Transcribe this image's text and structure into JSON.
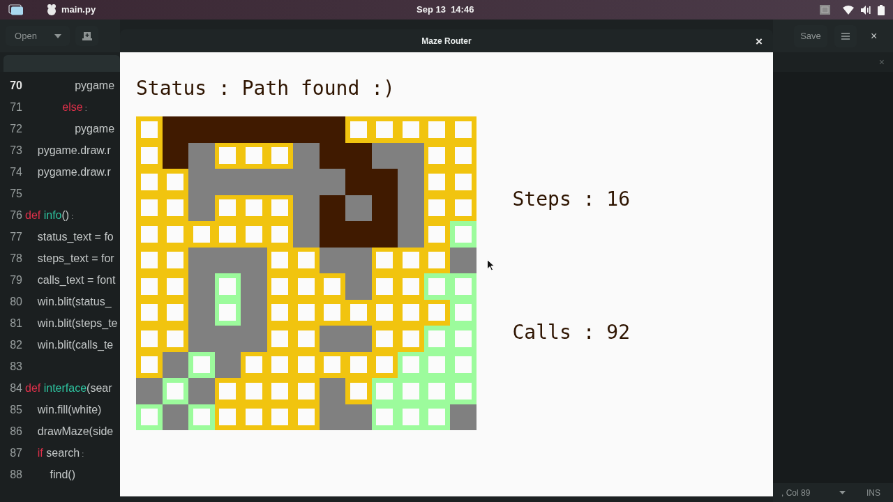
{
  "top_bar": {
    "app_title": "main.py",
    "clock": "Sep 13  14:46"
  },
  "editor": {
    "open_button": "Open",
    "save_button": "Save",
    "tab_close": "×",
    "window_close": "×",
    "lines": [
      {
        "number": "70",
        "current": true,
        "tokens": [
          {
            "text": "                pygame",
            "kind": "plain"
          }
        ]
      },
      {
        "number": "71",
        "current": false,
        "tokens": [
          {
            "text": "            else",
            "kind": "keyword"
          },
          {
            "text": " :",
            "kind": "punct"
          }
        ]
      },
      {
        "number": "72",
        "current": false,
        "tokens": [
          {
            "text": "                pygame",
            "kind": "plain"
          }
        ]
      },
      {
        "number": "73",
        "current": false,
        "tokens": [
          {
            "text": "    pygame.draw.r",
            "kind": "plain"
          }
        ]
      },
      {
        "number": "74",
        "current": false,
        "tokens": [
          {
            "text": "    pygame.draw.r",
            "kind": "plain"
          }
        ]
      },
      {
        "number": "75",
        "current": false
      },
      {
        "number": "76",
        "current": false,
        "tokens": [
          {
            "text": "def",
            "kind": "keyword"
          },
          {
            "text": " info",
            "kind": "function"
          },
          {
            "text": "()",
            "kind": "plain"
          },
          {
            "text": " :",
            "kind": "punct"
          }
        ]
      },
      {
        "number": "77",
        "current": false,
        "tokens": [
          {
            "text": "    status_text = fo",
            "kind": "plain"
          }
        ]
      },
      {
        "number": "78",
        "current": false,
        "tokens": [
          {
            "text": "    steps_text = for",
            "kind": "plain"
          }
        ]
      },
      {
        "number": "79",
        "current": false,
        "tokens": [
          {
            "text": "    calls_text = font",
            "kind": "plain"
          }
        ]
      },
      {
        "number": "80",
        "current": false,
        "tokens": [
          {
            "text": "    win.blit(status_",
            "kind": "plain"
          }
        ]
      },
      {
        "number": "81",
        "current": false,
        "tokens": [
          {
            "text": "    win.blit(steps_te",
            "kind": "plain"
          }
        ]
      },
      {
        "number": "82",
        "current": false,
        "tokens": [
          {
            "text": "    win.blit(calls_te",
            "kind": "plain"
          }
        ]
      },
      {
        "number": "83",
        "current": false
      },
      {
        "number": "84",
        "current": false,
        "tokens": [
          {
            "text": "def",
            "kind": "keyword"
          },
          {
            "text": " interface",
            "kind": "function"
          },
          {
            "text": "(sear",
            "kind": "plain"
          }
        ]
      },
      {
        "number": "85",
        "current": false,
        "tokens": [
          {
            "text": "    win.fill(white)",
            "kind": "plain"
          }
        ]
      },
      {
        "number": "86",
        "current": false,
        "tokens": [
          {
            "text": "    drawMaze(side",
            "kind": "plain"
          }
        ]
      },
      {
        "number": "87",
        "current": false,
        "tokens": [
          {
            "text": "    if",
            "kind": "keyword"
          },
          {
            "text": " search",
            "kind": "plain"
          },
          {
            "text": " :",
            "kind": "punct"
          }
        ]
      },
      {
        "number": "88",
        "current": false,
        "tokens": [
          {
            "text": "        find()",
            "kind": "plain"
          }
        ]
      }
    ],
    "status_bar": {
      "position": ", Col 89",
      "mode": "INS"
    }
  },
  "maze_window": {
    "title": "Maze Router",
    "close": "×",
    "status": "Status : Path found :)",
    "steps": "Steps : 16",
    "calls": "Calls : 92",
    "maze": {
      "rows": [
        {
          "cells": [
            {
              "kind": "visited"
            },
            {
              "kind": "path"
            },
            {
              "kind": "path"
            },
            {
              "kind": "path"
            },
            {
              "kind": "path"
            },
            {
              "kind": "path"
            },
            {
              "kind": "path"
            },
            {
              "kind": "path"
            },
            {
              "kind": "visited"
            },
            {
              "kind": "visited"
            },
            {
              "kind": "visited"
            },
            {
              "kind": "visited"
            },
            {
              "kind": "visited"
            }
          ]
        },
        {
          "cells": [
            {
              "kind": "visited"
            },
            {
              "kind": "path"
            },
            {
              "kind": "wall"
            },
            {
              "kind": "visited"
            },
            {
              "kind": "visited"
            },
            {
              "kind": "visited"
            },
            {
              "kind": "wall"
            },
            {
              "kind": "path"
            },
            {
              "kind": "path"
            },
            {
              "kind": "wall"
            },
            {
              "kind": "wall"
            },
            {
              "kind": "visited"
            },
            {
              "kind": "visited"
            }
          ]
        },
        {
          "cells": [
            {
              "kind": "visited"
            },
            {
              "kind": "visited"
            },
            {
              "kind": "wall"
            },
            {
              "kind": "wall"
            },
            {
              "kind": "wall"
            },
            {
              "kind": "wall"
            },
            {
              "kind": "wall"
            },
            {
              "kind": "wall"
            },
            {
              "kind": "path"
            },
            {
              "kind": "path"
            },
            {
              "kind": "wall"
            },
            {
              "kind": "visited"
            },
            {
              "kind": "visited"
            }
          ]
        },
        {
          "cells": [
            {
              "kind": "visited"
            },
            {
              "kind": "visited"
            },
            {
              "kind": "wall"
            },
            {
              "kind": "visited"
            },
            {
              "kind": "visited"
            },
            {
              "kind": "visited"
            },
            {
              "kind": "wall"
            },
            {
              "kind": "path"
            },
            {
              "kind": "wall"
            },
            {
              "kind": "path"
            },
            {
              "kind": "wall"
            },
            {
              "kind": "visited"
            },
            {
              "kind": "visited"
            }
          ]
        },
        {
          "cells": [
            {
              "kind": "visited"
            },
            {
              "kind": "visited"
            },
            {
              "kind": "visited"
            },
            {
              "kind": "visited"
            },
            {
              "kind": "visited"
            },
            {
              "kind": "visited"
            },
            {
              "kind": "wall"
            },
            {
              "kind": "path"
            },
            {
              "kind": "path"
            },
            {
              "kind": "path"
            },
            {
              "kind": "wall"
            },
            {
              "kind": "visited"
            },
            {
              "kind": "frontier"
            }
          ]
        },
        {
          "cells": [
            {
              "kind": "visited"
            },
            {
              "kind": "visited"
            },
            {
              "kind": "wall"
            },
            {
              "kind": "wall"
            },
            {
              "kind": "wall"
            },
            {
              "kind": "visited"
            },
            {
              "kind": "visited"
            },
            {
              "kind": "wall"
            },
            {
              "kind": "wall"
            },
            {
              "kind": "visited"
            },
            {
              "kind": "visited"
            },
            {
              "kind": "visited"
            },
            {
              "kind": "wall"
            }
          ]
        },
        {
          "cells": [
            {
              "kind": "visited"
            },
            {
              "kind": "visited"
            },
            {
              "kind": "wall"
            },
            {
              "kind": "frontier"
            },
            {
              "kind": "wall"
            },
            {
              "kind": "visited"
            },
            {
              "kind": "visited"
            },
            {
              "kind": "visited"
            },
            {
              "kind": "wall"
            },
            {
              "kind": "visited"
            },
            {
              "kind": "visited"
            },
            {
              "kind": "frontier"
            },
            {
              "kind": "frontier"
            }
          ]
        },
        {
          "cells": [
            {
              "kind": "visited"
            },
            {
              "kind": "visited"
            },
            {
              "kind": "wall"
            },
            {
              "kind": "frontier"
            },
            {
              "kind": "wall"
            },
            {
              "kind": "visited"
            },
            {
              "kind": "visited"
            },
            {
              "kind": "visited"
            },
            {
              "kind": "visited"
            },
            {
              "kind": "visited"
            },
            {
              "kind": "visited"
            },
            {
              "kind": "visited"
            },
            {
              "kind": "frontier"
            }
          ]
        },
        {
          "cells": [
            {
              "kind": "visited"
            },
            {
              "kind": "visited"
            },
            {
              "kind": "wall"
            },
            {
              "kind": "wall"
            },
            {
              "kind": "wall"
            },
            {
              "kind": "visited"
            },
            {
              "kind": "visited"
            },
            {
              "kind": "wall"
            },
            {
              "kind": "wall"
            },
            {
              "kind": "visited"
            },
            {
              "kind": "visited"
            },
            {
              "kind": "frontier"
            },
            {
              "kind": "frontier"
            }
          ]
        },
        {
          "cells": [
            {
              "kind": "visited"
            },
            {
              "kind": "wall"
            },
            {
              "kind": "frontier"
            },
            {
              "kind": "wall"
            },
            {
              "kind": "visited"
            },
            {
              "kind": "visited"
            },
            {
              "kind": "visited"
            },
            {
              "kind": "visited"
            },
            {
              "kind": "visited"
            },
            {
              "kind": "visited"
            },
            {
              "kind": "frontier"
            },
            {
              "kind": "frontier"
            },
            {
              "kind": "frontier"
            }
          ]
        },
        {
          "cells": [
            {
              "kind": "wall"
            },
            {
              "kind": "frontier"
            },
            {
              "kind": "wall"
            },
            {
              "kind": "visited"
            },
            {
              "kind": "visited"
            },
            {
              "kind": "visited"
            },
            {
              "kind": "visited"
            },
            {
              "kind": "wall"
            },
            {
              "kind": "visited"
            },
            {
              "kind": "frontier"
            },
            {
              "kind": "frontier"
            },
            {
              "kind": "frontier"
            },
            {
              "kind": "frontier"
            }
          ]
        },
        {
          "cells": [
            {
              "kind": "frontier"
            },
            {
              "kind": "wall"
            },
            {
              "kind": "frontier"
            },
            {
              "kind": "visited"
            },
            {
              "kind": "visited"
            },
            {
              "kind": "visited"
            },
            {
              "kind": "visited"
            },
            {
              "kind": "wall"
            },
            {
              "kind": "wall"
            },
            {
              "kind": "frontier"
            },
            {
              "kind": "frontier"
            },
            {
              "kind": "frontier"
            },
            {
              "kind": "wall"
            }
          ]
        }
      ]
    }
  }
}
